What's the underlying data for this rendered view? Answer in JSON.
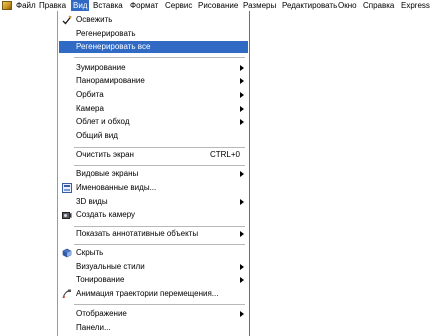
{
  "menubar": {
    "items": [
      "Файл",
      "Правка",
      "Вид",
      "Вставка",
      "Формат",
      "Сервис",
      "Рисование",
      "Размеры",
      "Редактировать",
      "Окно",
      "Справка",
      "Express"
    ]
  },
  "menu": {
    "items": [
      {
        "label": "Освежить",
        "icon": "check-pencil-icon"
      },
      {
        "label": "Регенерировать"
      },
      {
        "label": "Регенерировать все",
        "highlighted": true
      },
      {
        "label": "Зумирование",
        "submenu": true
      },
      {
        "label": "Панорамирование",
        "submenu": true
      },
      {
        "label": "Орбита",
        "submenu": true
      },
      {
        "label": "Камера",
        "submenu": true
      },
      {
        "label": "Облет и обход",
        "submenu": true
      },
      {
        "label": "Общий вид"
      },
      {
        "label": "Очистить экран",
        "shortcut": "CTRL+0"
      },
      {
        "label": "Видовые экраны",
        "submenu": true
      },
      {
        "label": "Именованные виды...",
        "icon": "named-views-icon"
      },
      {
        "label": "3D виды",
        "submenu": true
      },
      {
        "label": "Создать камеру",
        "icon": "camera-icon"
      },
      {
        "label": "Показать аннотативные объекты",
        "submenu": true
      },
      {
        "label": "Скрыть",
        "icon": "hide-icon"
      },
      {
        "label": "Визуальные стили",
        "submenu": true
      },
      {
        "label": "Тонирование",
        "submenu": true
      },
      {
        "label": "Анимация траектории перемещения...",
        "icon": "motion-path-icon"
      },
      {
        "label": "Отображение",
        "submenu": true
      },
      {
        "label": "Панели..."
      }
    ]
  },
  "colors": {
    "highlight": "#316ac5"
  }
}
